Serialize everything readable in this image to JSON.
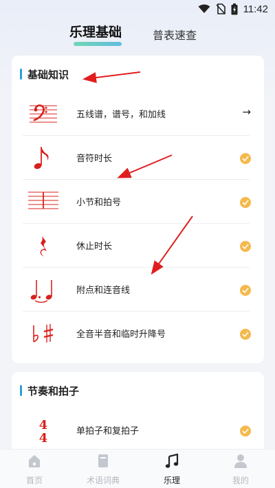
{
  "status_bar": {
    "time": "11:42"
  },
  "top_tabs": {
    "active": "乐理基础",
    "inactive": "普表速查"
  },
  "sections": [
    {
      "title": "基础知识",
      "items": [
        {
          "label": "五线谱，谱号，和加线",
          "trailing": "→",
          "icon": "bass-clef-staff-icon"
        },
        {
          "label": "音符时长",
          "trailing": "check",
          "icon": "eighth-note-icon"
        },
        {
          "label": "小节和拍号",
          "trailing": "check",
          "icon": "measure-barline-icon"
        },
        {
          "label": "休止时长",
          "trailing": "check",
          "icon": "quarter-rest-icon"
        },
        {
          "label": "附点和连音线",
          "trailing": "check",
          "icon": "dotted-tied-notes-icon"
        },
        {
          "label": "全音半音和临时升降号",
          "trailing": "check",
          "icon": "flat-sharp-icon"
        }
      ]
    },
    {
      "title": "节奏和拍子",
      "items": [
        {
          "label": "单拍子和复拍子",
          "trailing": "check",
          "icon": "time-signature-4-4-icon"
        }
      ]
    }
  ],
  "time_signature_glyph": {
    "top": "4",
    "bottom": "4"
  },
  "bottom_nav": [
    {
      "label": "首页",
      "icon": "home-icon",
      "active": false
    },
    {
      "label": "术语词典",
      "icon": "book-icon",
      "active": false
    },
    {
      "label": "乐理",
      "icon": "music-note-icon",
      "active": true
    },
    {
      "label": "我的",
      "icon": "person-icon",
      "active": false
    }
  ],
  "colors": {
    "accent_red": "#d8211c",
    "check_orange": "#f5b94d",
    "section_bar_blue": "#2a9fd8",
    "tab_underline": "#5ad1a9"
  }
}
